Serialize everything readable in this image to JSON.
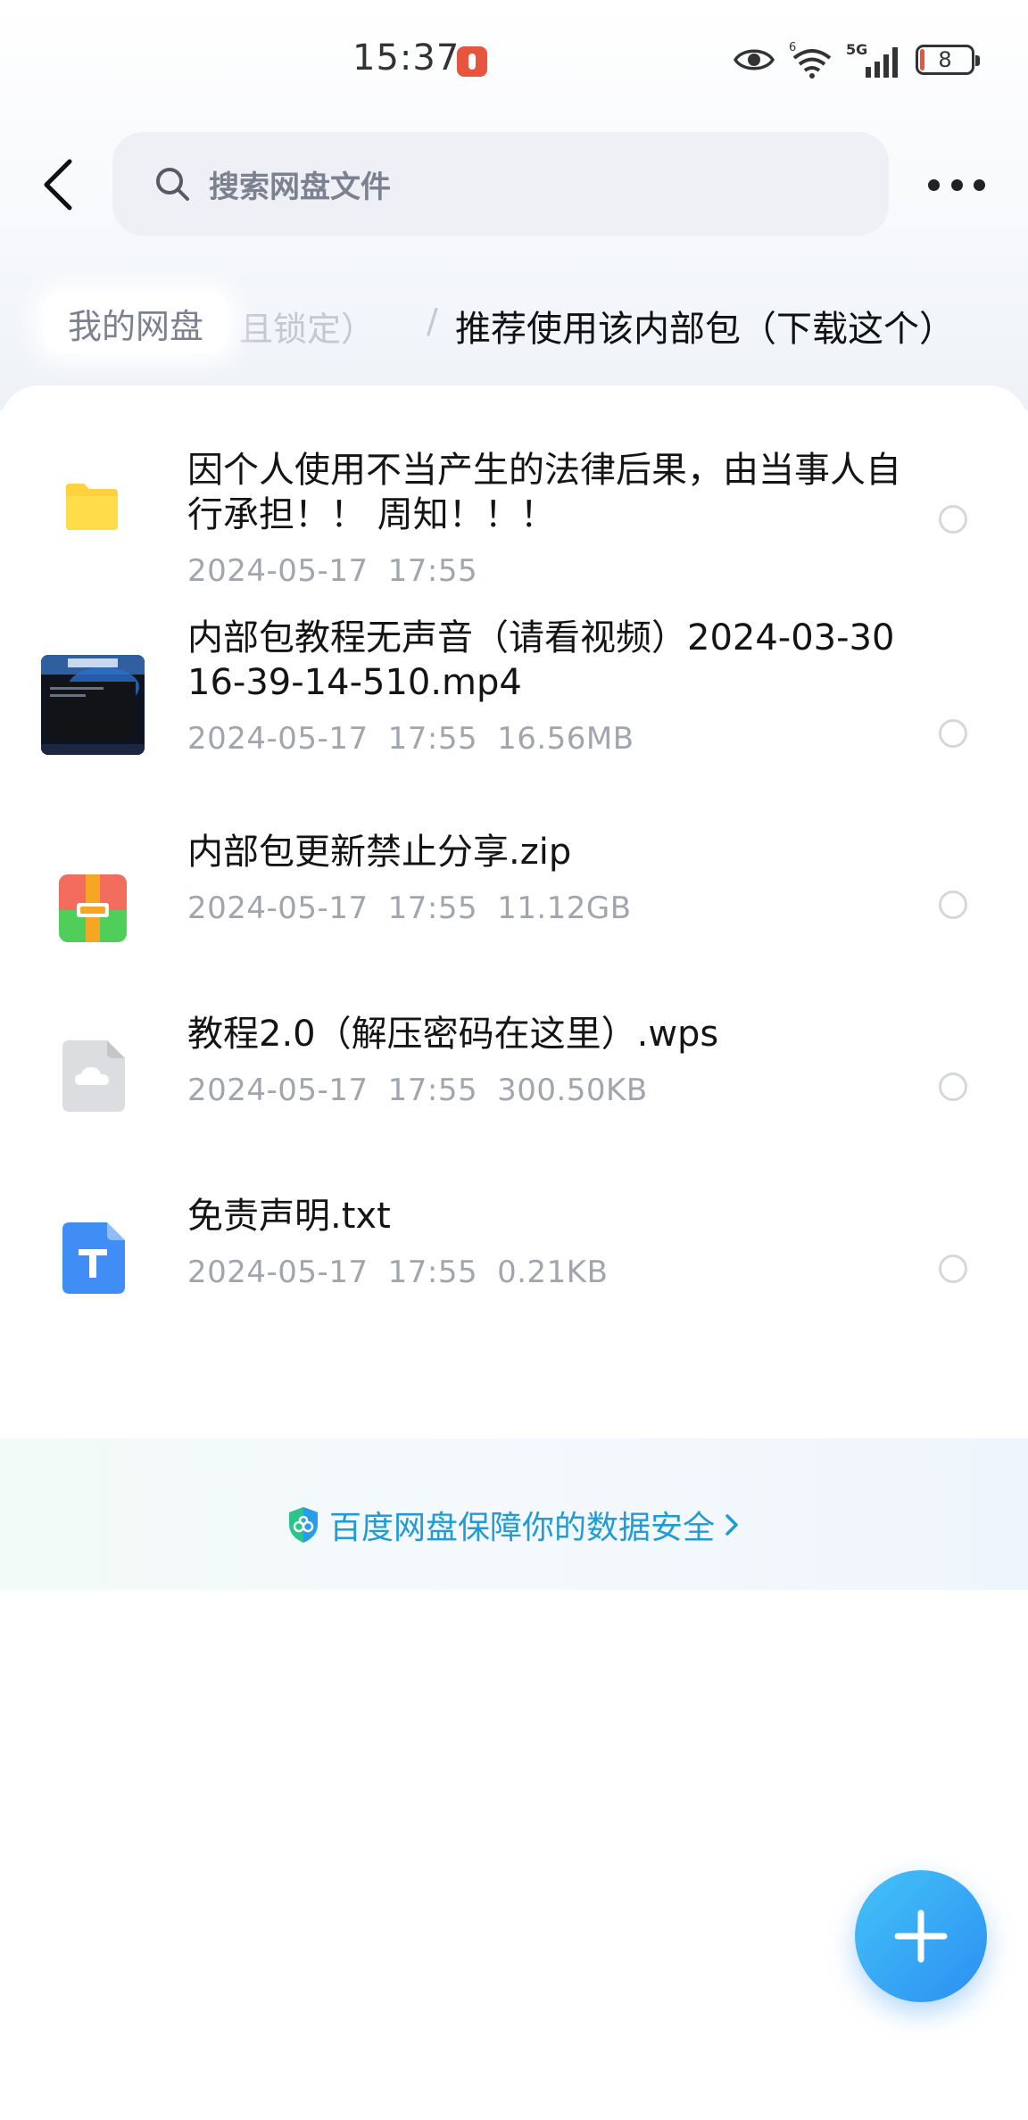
{
  "status_bar": {
    "time": "15:37",
    "wifi_badge": "6",
    "network": "5G",
    "battery": "8"
  },
  "header": {
    "search_placeholder": "搜索网盘文件"
  },
  "breadcrumb": {
    "root": "我的网盘",
    "hidden_fragment": "且锁定）",
    "separator": "/",
    "current": "推荐使用该内部包（下载这个）"
  },
  "files": [
    {
      "name": "因个人使用不当产生的法律后果，由当事人自行承担！！ 周知！！！",
      "date": "2024-05-17",
      "time": "17:55",
      "size": "",
      "icon": "folder-icon"
    },
    {
      "name": "内部包教程无声音（请看视频）2024-03-30 16-39-14-510.mp4",
      "date": "2024-05-17",
      "time": "17:55",
      "size": "16.56MB",
      "icon": "video-thumbnail"
    },
    {
      "name": "内部包更新禁止分享.zip",
      "date": "2024-05-17",
      "time": "17:55",
      "size": "11.12GB",
      "icon": "zip-archive-icon"
    },
    {
      "name": "教程2.0（解压密码在这里）.wps",
      "date": "2024-05-17",
      "time": "17:55",
      "size": "300.50KB",
      "icon": "cloud-document-icon"
    },
    {
      "name": "免责声明.txt",
      "date": "2024-05-17",
      "time": "17:55",
      "size": "0.21KB",
      "icon": "text-file-icon"
    }
  ],
  "footer": {
    "safety_text": "百度网盘保障你的数据安全"
  },
  "colors": {
    "accent": "#2b8ff2",
    "link": "#1f9bd6",
    "folder": "#fdd23c"
  }
}
